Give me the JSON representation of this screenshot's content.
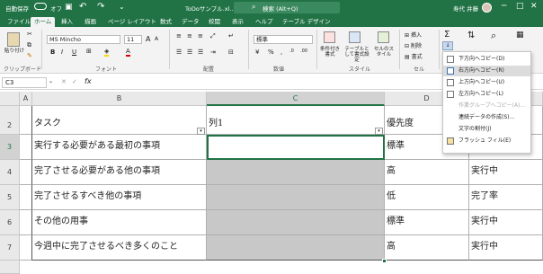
{
  "titlebar": {
    "autosave_label": "自動保存",
    "autosave_state": "オフ",
    "file_name": "ToDoサンプル.xl…",
    "search_placeholder": "検索 (Alt+Q)",
    "user_name": "寿代 井藤"
  },
  "tabs": [
    "ファイル",
    "ホーム",
    "挿入",
    "描画",
    "ページ レイアウト",
    "数式",
    "データ",
    "校閲",
    "表示",
    "ヘルプ",
    "テーブル デザイン"
  ],
  "active_tab": "ホーム",
  "ribbon": {
    "groups": {
      "clipboard": "クリップボード",
      "font": "フォント",
      "alignment": "配置",
      "number": "数値",
      "styles": "スタイル",
      "cells": "セル"
    },
    "clipboard": {
      "paste": "貼り付け"
    },
    "font": {
      "name": "MS Mincho",
      "size": "11",
      "bold": "B",
      "italic": "I",
      "underline": "U",
      "grow": "A",
      "shrink": "A",
      "font_color": "A"
    },
    "number": {
      "format": "標準"
    },
    "styles": {
      "conditional": "条件付き書式",
      "table": "テーブルとして書式設定",
      "cell_styles": "セルのスタイル"
    },
    "cells": {
      "insert": "挿入",
      "delete": "削除",
      "format": "書式"
    },
    "editing": {
      "autosum": "Σ",
      "sort": "並べ替えとフィルター",
      "find": "検索と選択"
    }
  },
  "fill_menu": [
    {
      "label": "下方向へコピー(D)",
      "state": "normal"
    },
    {
      "label": "右方向へコピー(R)",
      "state": "highlight"
    },
    {
      "label": "上方向へコピー(U)",
      "state": "normal"
    },
    {
      "label": "左方向へコピー(L)",
      "state": "normal"
    },
    {
      "label": "作業グループへコピー(A)...",
      "state": "disabled"
    },
    {
      "label": "連続データの作成(S)...",
      "state": "normal"
    },
    {
      "label": "文字の割付(J)",
      "state": "normal"
    },
    {
      "label": "フラッシュ フィル(E)",
      "state": "normal"
    }
  ],
  "formula_bar": {
    "name_box": "C3",
    "fx": "fx",
    "value": ""
  },
  "columns": [
    "A",
    "B",
    "C",
    "D",
    "E"
  ],
  "rows": [
    "2",
    "3",
    "4",
    "5",
    "6",
    "7"
  ],
  "table": {
    "headers": [
      "タスク",
      "列1",
      "優先度",
      ""
    ],
    "rows": [
      [
        "実行する必要がある最初の事項",
        "",
        "標準",
        ""
      ],
      [
        "完了させる必要がある他の事項",
        "",
        "高",
        "実行中"
      ],
      [
        "完了させるすべき他の事項",
        "",
        "低",
        "完了率"
      ],
      [
        "その他の用事",
        "",
        "標準",
        "実行中"
      ],
      [
        "今週中に完了させるべき多くのこと",
        "",
        "高",
        "実行中"
      ]
    ]
  },
  "colors": {
    "excel_green": "#217346",
    "selection_gray": "#c8c8c8",
    "highlight": "#dcdcdc"
  }
}
